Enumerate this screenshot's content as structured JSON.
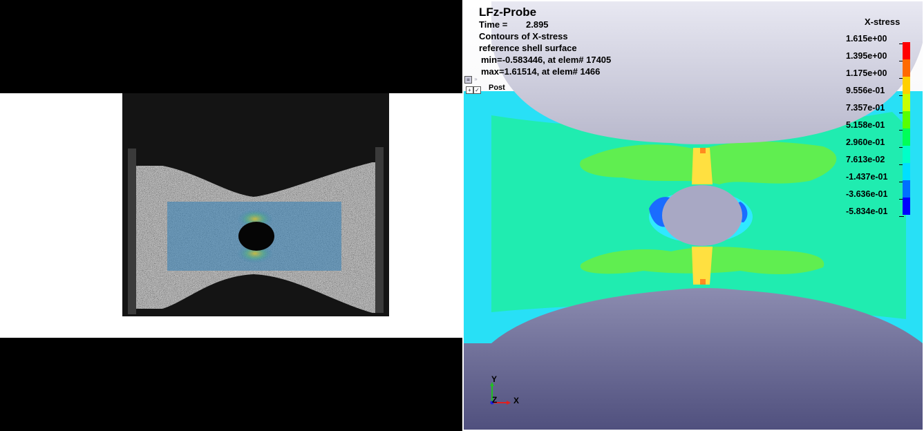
{
  "fem": {
    "title": "LFz-Probe",
    "time_label": "Time =",
    "time_value": "2.895",
    "contours_text": "Contours of X-stress",
    "surface_text": "reference shell surface",
    "min_text": "min=-0.583446, at elem# 17405",
    "max_text": "max=1.61514, at elem# 1466",
    "part_label": "Post",
    "legend": {
      "title": "X-stress",
      "labels": [
        "1.615e+00",
        "1.395e+00",
        "1.175e+00",
        "9.556e-01",
        "7.357e-01",
        "5.158e-01",
        "2.960e-01",
        "7.613e-02",
        "-1.437e-01",
        "-3.636e-01",
        "-5.834e-01"
      ],
      "colors": [
        "#ff0000",
        "#ff6a00",
        "#ffd000",
        "#c8ff00",
        "#58ff00",
        "#00ff58",
        "#00ffc8",
        "#00e0ff",
        "#0070ff",
        "#0000ff"
      ]
    },
    "axes": {
      "y": "Y",
      "z": "Z",
      "x": "X"
    }
  }
}
